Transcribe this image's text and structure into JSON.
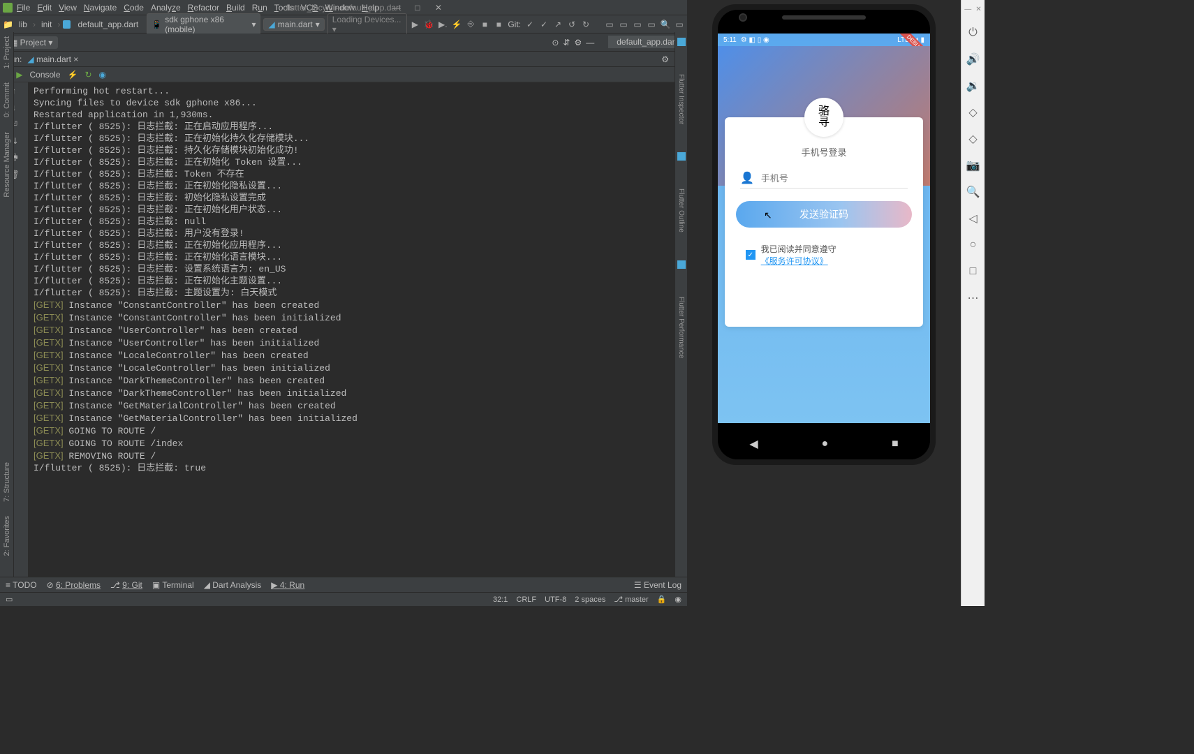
{
  "menu": {
    "file": "File",
    "edit": "Edit",
    "view": "View",
    "navigate": "Navigate",
    "code": "Code",
    "analyze": "Analyze",
    "refactor": "Refactor",
    "build": "Build",
    "run": "Run",
    "tools": "Tools",
    "vcs": "VCS",
    "window": "Window",
    "help": "Help",
    "title": "flutter_locyin - default_app.dart"
  },
  "nav": {
    "crumb1": "lib",
    "crumb2": "init",
    "crumb3": "default_app.dart",
    "device": "sdk gphone x86 (mobile)",
    "runfile": "main.dart",
    "loading": "Loading Devices...",
    "git": "Git:"
  },
  "project": {
    "label": "Project",
    "tab": "default_app.dart"
  },
  "run": {
    "label": "Run:",
    "tab": "main.dart",
    "console": "Console"
  },
  "console_lines": [
    "Performing hot restart...",
    "Syncing files to device sdk gphone x86...",
    "Restarted application in 1,930ms.",
    "I/flutter ( 8525): 日志拦截: 正在启动应用程序...",
    "I/flutter ( 8525): 日志拦截: 正在初始化持久化存储模块...",
    "I/flutter ( 8525): 日志拦截: 持久化存储模块初始化成功!",
    "I/flutter ( 8525): 日志拦截: 正在初始化 Token 设置...",
    "I/flutter ( 8525): 日志拦截: Token 不存在",
    "I/flutter ( 8525): 日志拦截: 正在初始化隐私设置...",
    "I/flutter ( 8525): 日志拦截: 初始化隐私设置完成",
    "I/flutter ( 8525): 日志拦截: 正在初始化用户状态...",
    "I/flutter ( 8525): 日志拦截: null",
    "I/flutter ( 8525): 日志拦截: 用户没有登录!",
    "I/flutter ( 8525): 日志拦截: 正在初始化应用程序...",
    "I/flutter ( 8525): 日志拦截: 正在初始化语言模块...",
    "I/flutter ( 8525): 日志拦截: 设置系统语言为: en_US",
    "I/flutter ( 8525): 日志拦截: 正在初始化主题设置...",
    "I/flutter ( 8525): 日志拦截: 主题设置为: 白天模式",
    "[GETX] Instance \"ConstantController\" has been created",
    "[GETX] Instance \"ConstantController\" has been initialized",
    "[GETX] Instance \"UserController\" has been created",
    "[GETX] Instance \"UserController\" has been initialized",
    "[GETX] Instance \"LocaleController\" has been created",
    "[GETX] Instance \"LocaleController\" has been initialized",
    "[GETX] Instance \"DarkThemeController\" has been created",
    "[GETX] Instance \"DarkThemeController\" has been initialized",
    "[GETX] Instance \"GetMaterialController\" has been created",
    "[GETX] Instance \"GetMaterialController\" has been initialized",
    "[GETX] GOING TO ROUTE /",
    "[GETX] GOING TO ROUTE /index",
    "[GETX] REMOVING ROUTE /",
    "I/flutter ( 8525): 日志拦截: true"
  ],
  "bottom": {
    "todo": "TODO",
    "problems": "6: Problems",
    "git": "9: Git",
    "terminal": "Terminal",
    "dart": "Dart Analysis",
    "run": "4: Run",
    "event": "Event Log"
  },
  "status": {
    "pos": "32:1",
    "crlf": "CRLF",
    "enc": "UTF-8",
    "spaces": "2 spaces",
    "branch": "master"
  },
  "leftstrip": {
    "project": "1: Project",
    "commit": "0: Commit",
    "resmgr": "Resource Manager",
    "structure": "7: Structure",
    "favorites": "2: Favorites"
  },
  "rightstrip": {
    "inspector": "Flutter Inspector",
    "outline": "Flutter Outline",
    "perf": "Flutter Performance"
  },
  "phone": {
    "time": "5:11",
    "debug": "DEBUG",
    "lte": "LTE",
    "title": "手机号登录",
    "placeholder": "手机号",
    "button": "发送验证码",
    "agree": "我已阅读并同意遵守",
    "link": "《服务许可协议》",
    "logo": "骆\n寻"
  }
}
